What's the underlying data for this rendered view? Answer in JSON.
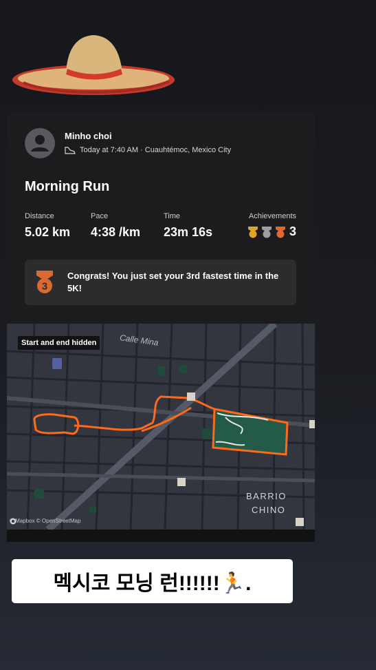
{
  "activity": {
    "user_name": "Minho choi",
    "meta": "Today at 7:40 AM · Cuauhtémoc, Mexico City",
    "title": "Morning Run",
    "stats": [
      {
        "label": "Distance",
        "value": "5.02 km"
      },
      {
        "label": "Pace",
        "value": "4:38 /km"
      },
      {
        "label": "Time",
        "value": "23m 16s"
      }
    ],
    "achievements": {
      "label": "Achievements",
      "count": "3",
      "medal_colors": [
        "#e0a42c",
        "#9a9da3",
        "#d86a32"
      ]
    },
    "congrats": {
      "badge_number": "3",
      "text": "Congrats! You just set your 3rd fastest time in the 5K!"
    }
  },
  "map": {
    "badge": "Start and end hidden",
    "street_label": "Calle Mina",
    "district_label_line1": "BARRIO",
    "district_label_line2": "CHINO",
    "attribution": "© Mapbox © OpenStreetMap",
    "route_color": "#ff6a1a"
  },
  "caption": {
    "text": "멕시코 모닝 런!!!!!!🏃."
  }
}
